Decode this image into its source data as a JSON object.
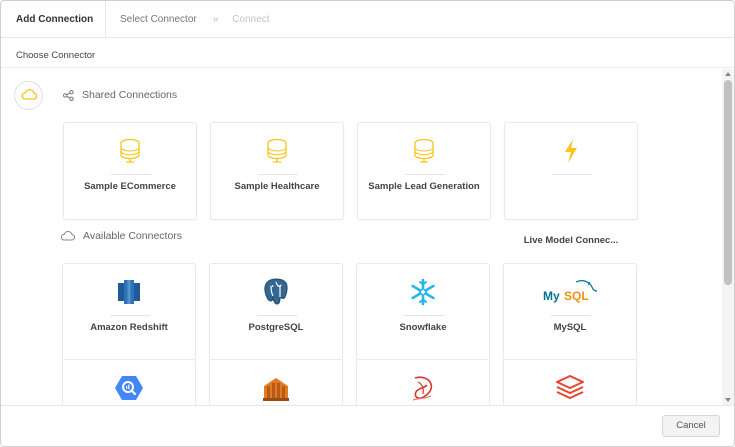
{
  "header": {
    "title": "Add Connection",
    "step1": "Select Connector",
    "separator": "»",
    "step2": "Connect"
  },
  "subheader": {
    "label": "Choose Connector"
  },
  "shared": {
    "title": "Shared Connections",
    "items": [
      {
        "label": "Sample ECommerce",
        "icon": "database-icon"
      },
      {
        "label": "Sample Healthcare",
        "icon": "database-icon"
      },
      {
        "label": "Sample Lead Generation",
        "icon": "database-icon"
      },
      {
        "label": "Live Model Connec...",
        "icon": "lightning-icon"
      }
    ]
  },
  "available": {
    "title": "Available Connectors",
    "items": [
      {
        "label": "Amazon Redshift",
        "icon": "amazon-redshift-icon"
      },
      {
        "label": "PostgreSQL",
        "icon": "postgresql-icon"
      },
      {
        "label": "Snowflake",
        "icon": "snowflake-icon"
      },
      {
        "label": "MySQL",
        "icon": "mysql-icon",
        "logo_text": "MySQL"
      },
      {
        "label": "",
        "icon": "bigquery-icon"
      },
      {
        "label": "",
        "icon": "aws-athena-icon"
      },
      {
        "label": "",
        "icon": "sql-server-icon"
      },
      {
        "label": "",
        "icon": "databricks-icon"
      }
    ]
  },
  "footer": {
    "cancel_label": "Cancel"
  },
  "colors": {
    "accent_yellow": "#F5C518",
    "redshift_blue": "#205B98",
    "postgres_blue": "#336791",
    "snowflake_cyan": "#29B5E8",
    "mysql_blue": "#00758F",
    "mysql_orange": "#F29111",
    "bigquery_blue": "#4386FA",
    "athena_orange": "#E07B24",
    "sqlserver_red": "#D9352B",
    "databricks_red": "#E8432E"
  }
}
